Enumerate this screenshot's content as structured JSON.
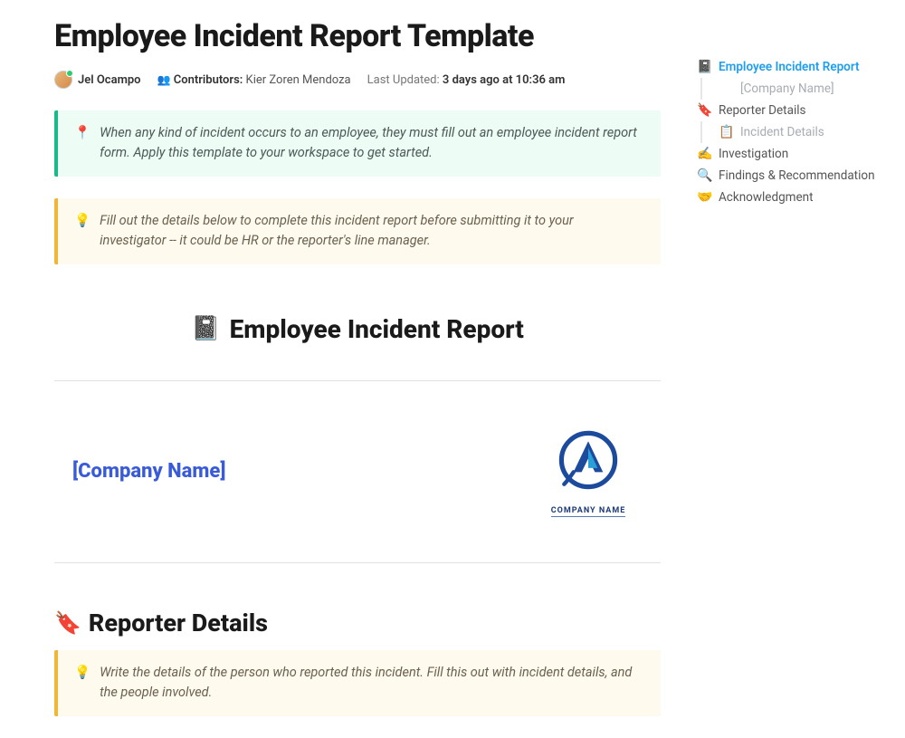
{
  "title": "Employee Incident Report Template",
  "meta": {
    "author": "Jel Ocampo",
    "contributors_label": "Contributors:",
    "contributors": "Kier Zoren Mendoza",
    "updated_label": "Last Updated:",
    "updated_value": "3 days ago at 10:36 am"
  },
  "callouts": {
    "intro_icon": "📍",
    "intro": "When any kind of incident occurs to an employee, they must fill out an employee incident report form. Apply this template to your workspace to get started.",
    "fill_icon": "💡",
    "fill": "Fill out the details below to complete this incident report before submitting it to your investigator -- it could be HR or the reporter's line manager.",
    "reporter_icon": "💡",
    "reporter": "Write the details of the person who reported this incident. Fill this out with incident details, and the people involved."
  },
  "sections": {
    "main_icon": "📓",
    "main_title": "Employee Incident Report",
    "company_placeholder": "[Company Name]",
    "company_logo_label": "COMPANY NAME",
    "reporter_icon": "🔖",
    "reporter_title": "Reporter Details"
  },
  "outline": {
    "items": [
      {
        "icon": "📓",
        "label": "Employee Incident Report",
        "active": true,
        "sub": false
      },
      {
        "icon": "",
        "label": "[Company Name]",
        "active": false,
        "sub": true
      },
      {
        "icon": "🔖",
        "label": "Reporter Details",
        "active": false,
        "sub": false
      },
      {
        "icon": "📋",
        "label": "Incident Details",
        "active": false,
        "sub": true
      },
      {
        "icon": "✍️",
        "label": "Investigation",
        "active": false,
        "sub": false
      },
      {
        "icon": "🔍",
        "label": "Findings & Recommendation",
        "active": false,
        "sub": false
      },
      {
        "icon": "🤝",
        "label": "Acknowledgment",
        "active": false,
        "sub": false
      }
    ]
  }
}
